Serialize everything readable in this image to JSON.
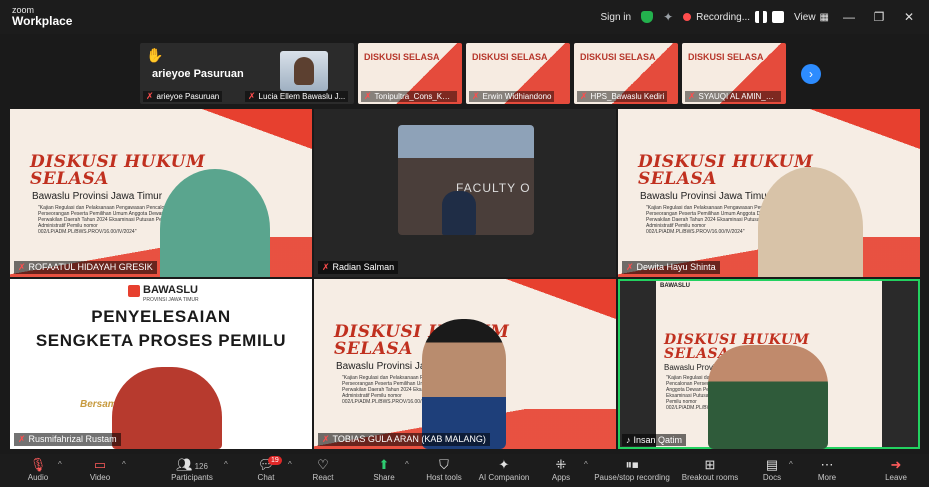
{
  "app": {
    "logo_top": "zoom",
    "logo_bottom": "Workplace"
  },
  "titlebar": {
    "sign_in": "Sign in",
    "recording": "Recording...",
    "view": "View"
  },
  "strip": {
    "raised_hand_name": "arieyoe Pasuruan",
    "thumbs": [
      {
        "name": "arieyoe Pasuruan"
      },
      {
        "name": "Lucia Ellem Bawaslu J..."
      },
      {
        "name": "Tonipultra_Cons_Kota..."
      },
      {
        "name": "Erwin Widhiandono"
      },
      {
        "name": "HPS_Bawaslu Kediri"
      },
      {
        "name": "SYAUQI AL AMIN_CP..."
      }
    ]
  },
  "slide_text": {
    "h_line1": "DISKUSI HUKUM",
    "h_line2": "SELASA",
    "seri": "Seri 6",
    "org": "Bawaslu Provinsi Jawa Timur",
    "desc": "\"Kajian Regulasi dan Pelaksanaan Pengawasan Pencalonan Perseorangan Peserta Pemilihan Umum Anggota Dewan Perwakilan Daerah Tahun 2024 Eksaminasi Putusan Pelanggaran Administratif Pemilu nomor 002/LP/ADM.PL/BWS.PROV/16.00/IV/2024\"",
    "mini_title": "DISKUSI SELASA",
    "faculty": "FACULTY O"
  },
  "bawaslu": {
    "brand": "BAWASLU",
    "prov": "PROVINSI JAWA TIMUR",
    "line1": "PENYELESAIAN",
    "line2": "SENGKETA PROSES PEMILU",
    "footer": "Bersama ... milu"
  },
  "tiles": [
    {
      "name": "ROFAATUL HIDAYAH GRESIK"
    },
    {
      "name": "Radian Salman"
    },
    {
      "name": "Dewita Hayu Shinta"
    },
    {
      "name": "Rusmifahrizal Rustam"
    },
    {
      "name": "TOBIAS GULA ARAN (KAB MALANG)"
    },
    {
      "name": "Insan Qatim"
    }
  ],
  "toolbar": {
    "audio": "Audio",
    "video": "Video",
    "participants": "Participants",
    "participants_count": "126",
    "chat": "Chat",
    "chat_badge": "19",
    "react": "React",
    "share": "Share",
    "host_tools": "Host tools",
    "ai_companion": "AI Companion",
    "apps": "Apps",
    "pause_stop": "Pause/stop recording",
    "breakout": "Breakout rooms",
    "docs": "Docs",
    "more": "More",
    "leave": "Leave"
  },
  "colors": {
    "accent": "#2d8cff",
    "active_speaker": "#23d160",
    "slide_red": "#e7402f"
  }
}
